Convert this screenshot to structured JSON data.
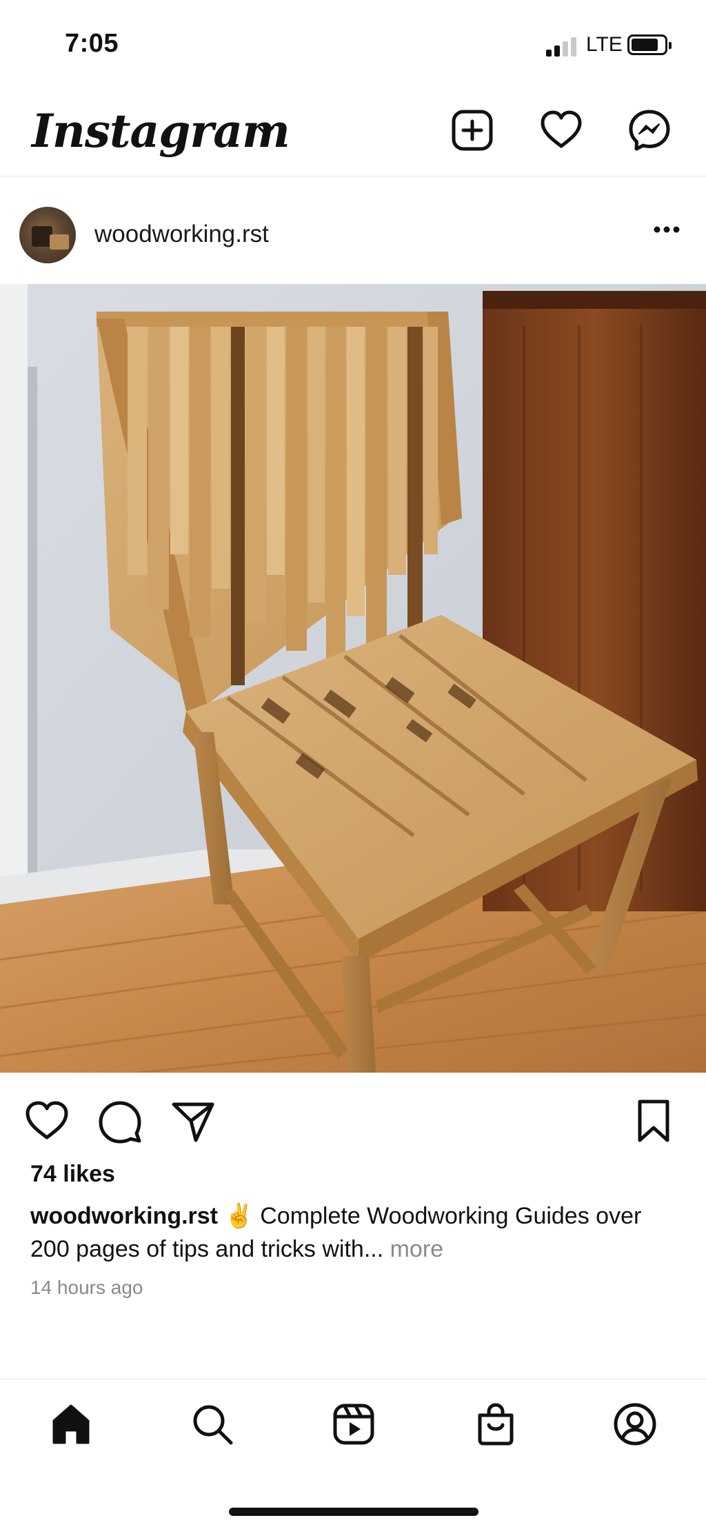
{
  "status_bar": {
    "time": "7:05",
    "network": "LTE"
  },
  "header": {
    "app_name": "Instagram"
  },
  "post": {
    "username": "woodworking.rst",
    "likes": "74 likes",
    "caption_user": "woodworking.rst",
    "caption_text": " ✌️ Complete Woodworking Guides over 200 pages of tips and tricks with... ",
    "caption_more": "more",
    "time_ago": "14 hours ago",
    "image_subject": "handcrafted oak chair with interlocking wood slats"
  },
  "icons": {
    "header": [
      "chevron-down-icon",
      "new-post-icon",
      "heart-icon",
      "messenger-icon"
    ],
    "actions": [
      "like-icon",
      "comment-icon",
      "share-icon",
      "bookmark-icon"
    ],
    "nav": [
      "home-icon",
      "search-icon",
      "reels-icon",
      "shop-icon",
      "profile-icon"
    ]
  }
}
